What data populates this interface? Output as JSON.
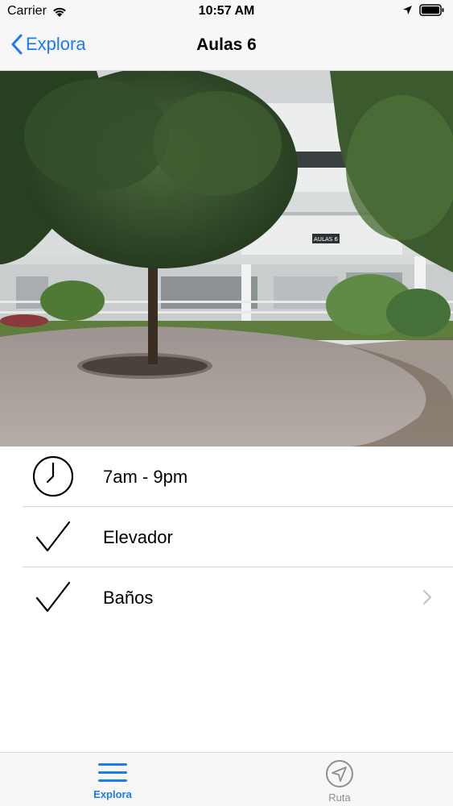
{
  "status_bar": {
    "carrier": "Carrier",
    "time": "10:57 AM"
  },
  "nav": {
    "back_label": "Explora",
    "title": "Aulas 6"
  },
  "hero": {
    "sign_text": "AULAS 6"
  },
  "info": {
    "items": [
      {
        "icon": "clock-icon",
        "label": "7am - 9pm"
      },
      {
        "icon": "checkmark-icon",
        "label": "Elevador"
      },
      {
        "icon": "checkmark-icon",
        "label": "Baños",
        "disclosure": true
      }
    ]
  },
  "tab_bar": {
    "tabs": [
      {
        "icon": "menu-icon",
        "label": "Explora",
        "selected": true
      },
      {
        "icon": "location-arrow-icon",
        "label": "Ruta",
        "selected": false
      }
    ]
  },
  "colors": {
    "accent": "#1a7cf0",
    "inactive": "#8e8e93"
  }
}
